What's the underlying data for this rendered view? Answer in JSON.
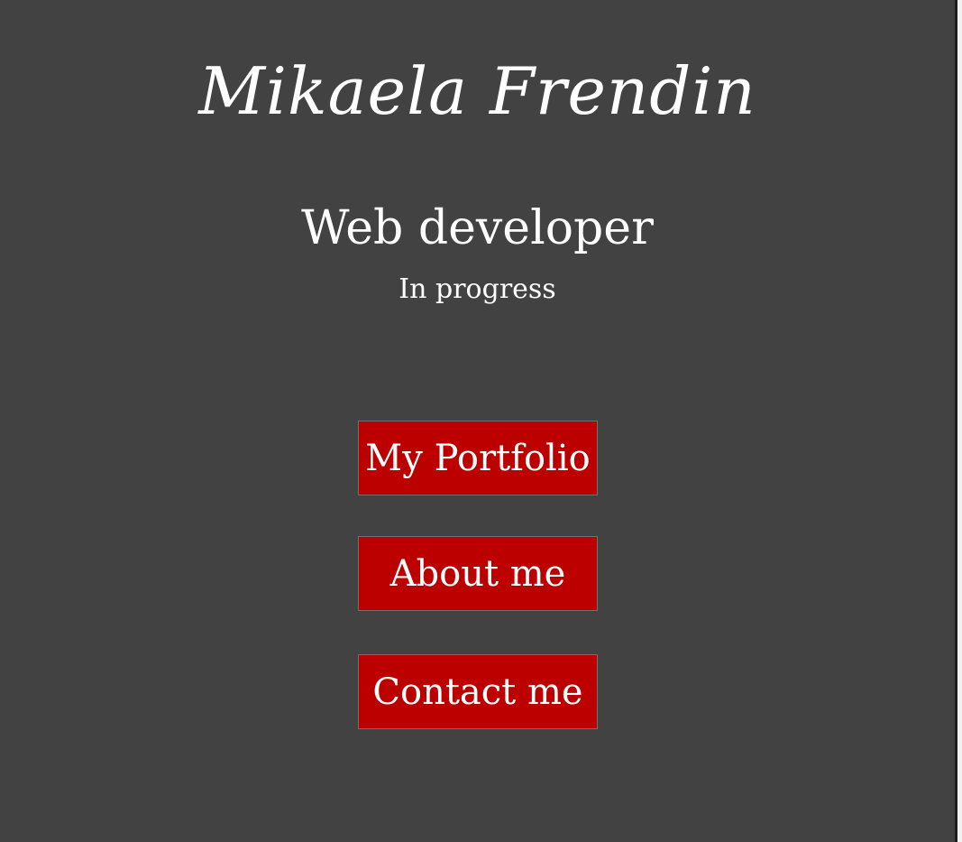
{
  "header": {
    "name": "Mikaela Frendin",
    "role": "Web developer",
    "status": "In progress"
  },
  "nav": {
    "portfolio_label": "My Portfolio",
    "about_label": "About me",
    "contact_label": "Contact me"
  },
  "colors": {
    "background": "#424242",
    "button": "#bc0000",
    "text": "#ffffff"
  }
}
